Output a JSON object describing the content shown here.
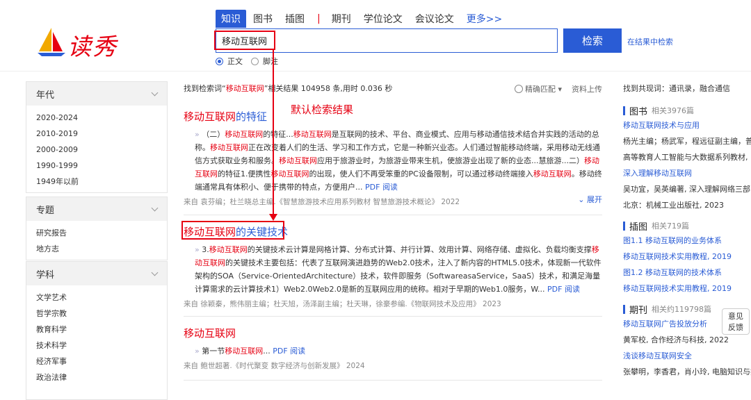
{
  "header": {
    "logo_text": "读秀",
    "tabs": [
      "知识",
      "图书",
      "插图",
      "期刊",
      "学位论文",
      "会议论文",
      "更多>>"
    ],
    "search_value": "移动互联网",
    "search_button": "检索",
    "search_within": "在结果中检索",
    "radio_options": [
      "正文",
      "脚注"
    ]
  },
  "sidebar": {
    "year": {
      "title": "年代",
      "items": [
        "2020-2024",
        "2010-2019",
        "2000-2009",
        "1990-1999",
        "1949年以前"
      ]
    },
    "topic": {
      "title": "专题",
      "items": [
        "研究报告",
        "地方志"
      ]
    },
    "subject": {
      "title": "学科",
      "items": [
        "文学艺术",
        "哲学宗教",
        "教育科学",
        "技术科学",
        "经济军事",
        "政治法律"
      ]
    }
  },
  "main": {
    "summary_prefix": "找到检索词“",
    "summary_term": "移动互联网",
    "summary_suffix": "”相关结果 104958 条,用时 0.036 秒",
    "sort_label": "精确匹配",
    "upload_label": "资料上传",
    "annotation": "默认检索结果",
    "expand_label": "展开",
    "results": [
      {
        "title_term": "移动互联网",
        "title_rest": "的特征",
        "body": "（二）移动互联网的特征...移动互联网是互联网的技术、平台、商业模式、应用与移动通信技术结合并实践的活动的总称。移动互联网正在改变着人们的生活、学习和工作方式，它是一种新兴业态。人们通过智能移动终端，采用移动无线通信方式获取业务和服务。移动互联网应用于旅游业时，为旅游业带来生机，使旅游业出现了新的业态...慧旅游...二）移动互联网的特征1.便携性移动互联网的出现，使人们不再受笨重的PC设备限制，可以通过移动终端接入移动互联网。移动终端通常具有体积小、便于携带的特点，方便用户...",
        "pdf": "PDF",
        "read": "阅读",
        "source": "来自 袁芬编；杜兰晓总主编.《智慧旅游技术应用系列教材 智慧旅游技术概论》 2022"
      },
      {
        "title_term": "移动互联网",
        "title_rest": "的关键技术",
        "body": "3.移动互联网的关键技术云计算是网格计算、分布式计算、并行计算、效用计算、网络存储、虚拟化、负载均衡支撑移动互联网的关键技术主要包括：代表了互联网演进趋势的Web2.0技术，注入了新内容的HTML5.0技术，体现新一代软件架构的SOA（Service-OrientedArchitecture）技术，软件即服务（SoftwareasaService，SaaS）技术，和满足海量计算需求的云计算技术1）Web2.0Web2.0是新的互联网应用的统称。相对于早期的Web1.0服务，W...",
        "pdf": "PDF",
        "read": "阅读",
        "source": "来自 徐颖秦，熊伟丽主编；杜天旭，汤泽副主编；杜天琳，徐豪参编.《物联网技术及应用》 2023"
      },
      {
        "title_term": "移动互联网",
        "title_rest": "",
        "body": "第一节移动互联网...",
        "pdf": "PDF",
        "read": "阅读",
        "source": "来自 鲍世超著.《时代聚变 数字经济与创新发展》 2024"
      }
    ]
  },
  "right": {
    "topic_label": "找到共现词：",
    "topic_words": "通讯录，融合通信",
    "books": {
      "title": "图书",
      "count": "相关3976篇",
      "lines": [
        "移动互联网技术与应用",
        "杨光主编；杨武军，程远征副主编，普通",
        "高等教育人工智能与大数据系列教材, ...",
        "深入理解移动互联网",
        "吴功宜，吴英编著, 深入理解网络三部曲,",
        "北京：机械工业出版社, 2023"
      ]
    },
    "figures": {
      "title": "插图",
      "count": "相关719篇",
      "lines": [
        "图1.1 移动互联网的业务体系",
        "移动互联网技术实用教程, 2019",
        "图1.2 移动互联网的技术体系",
        "移动互联网技术实用教程, 2019"
      ]
    },
    "journals": {
      "title": "期刊",
      "count": "相关约119798篇",
      "lines": [
        "移动互联网广告投放分析",
        "黄军校, 合作经济与科技, 2022",
        "浅谈移动互联网安全",
        "张攀明，李香君，肖小玲, 电脑知识与技"
      ]
    }
  },
  "feedback": {
    "line1": "意见",
    "line2": "反馈"
  },
  "colors": {
    "accent": "#2a5cd5",
    "highlight": "#e60012"
  }
}
